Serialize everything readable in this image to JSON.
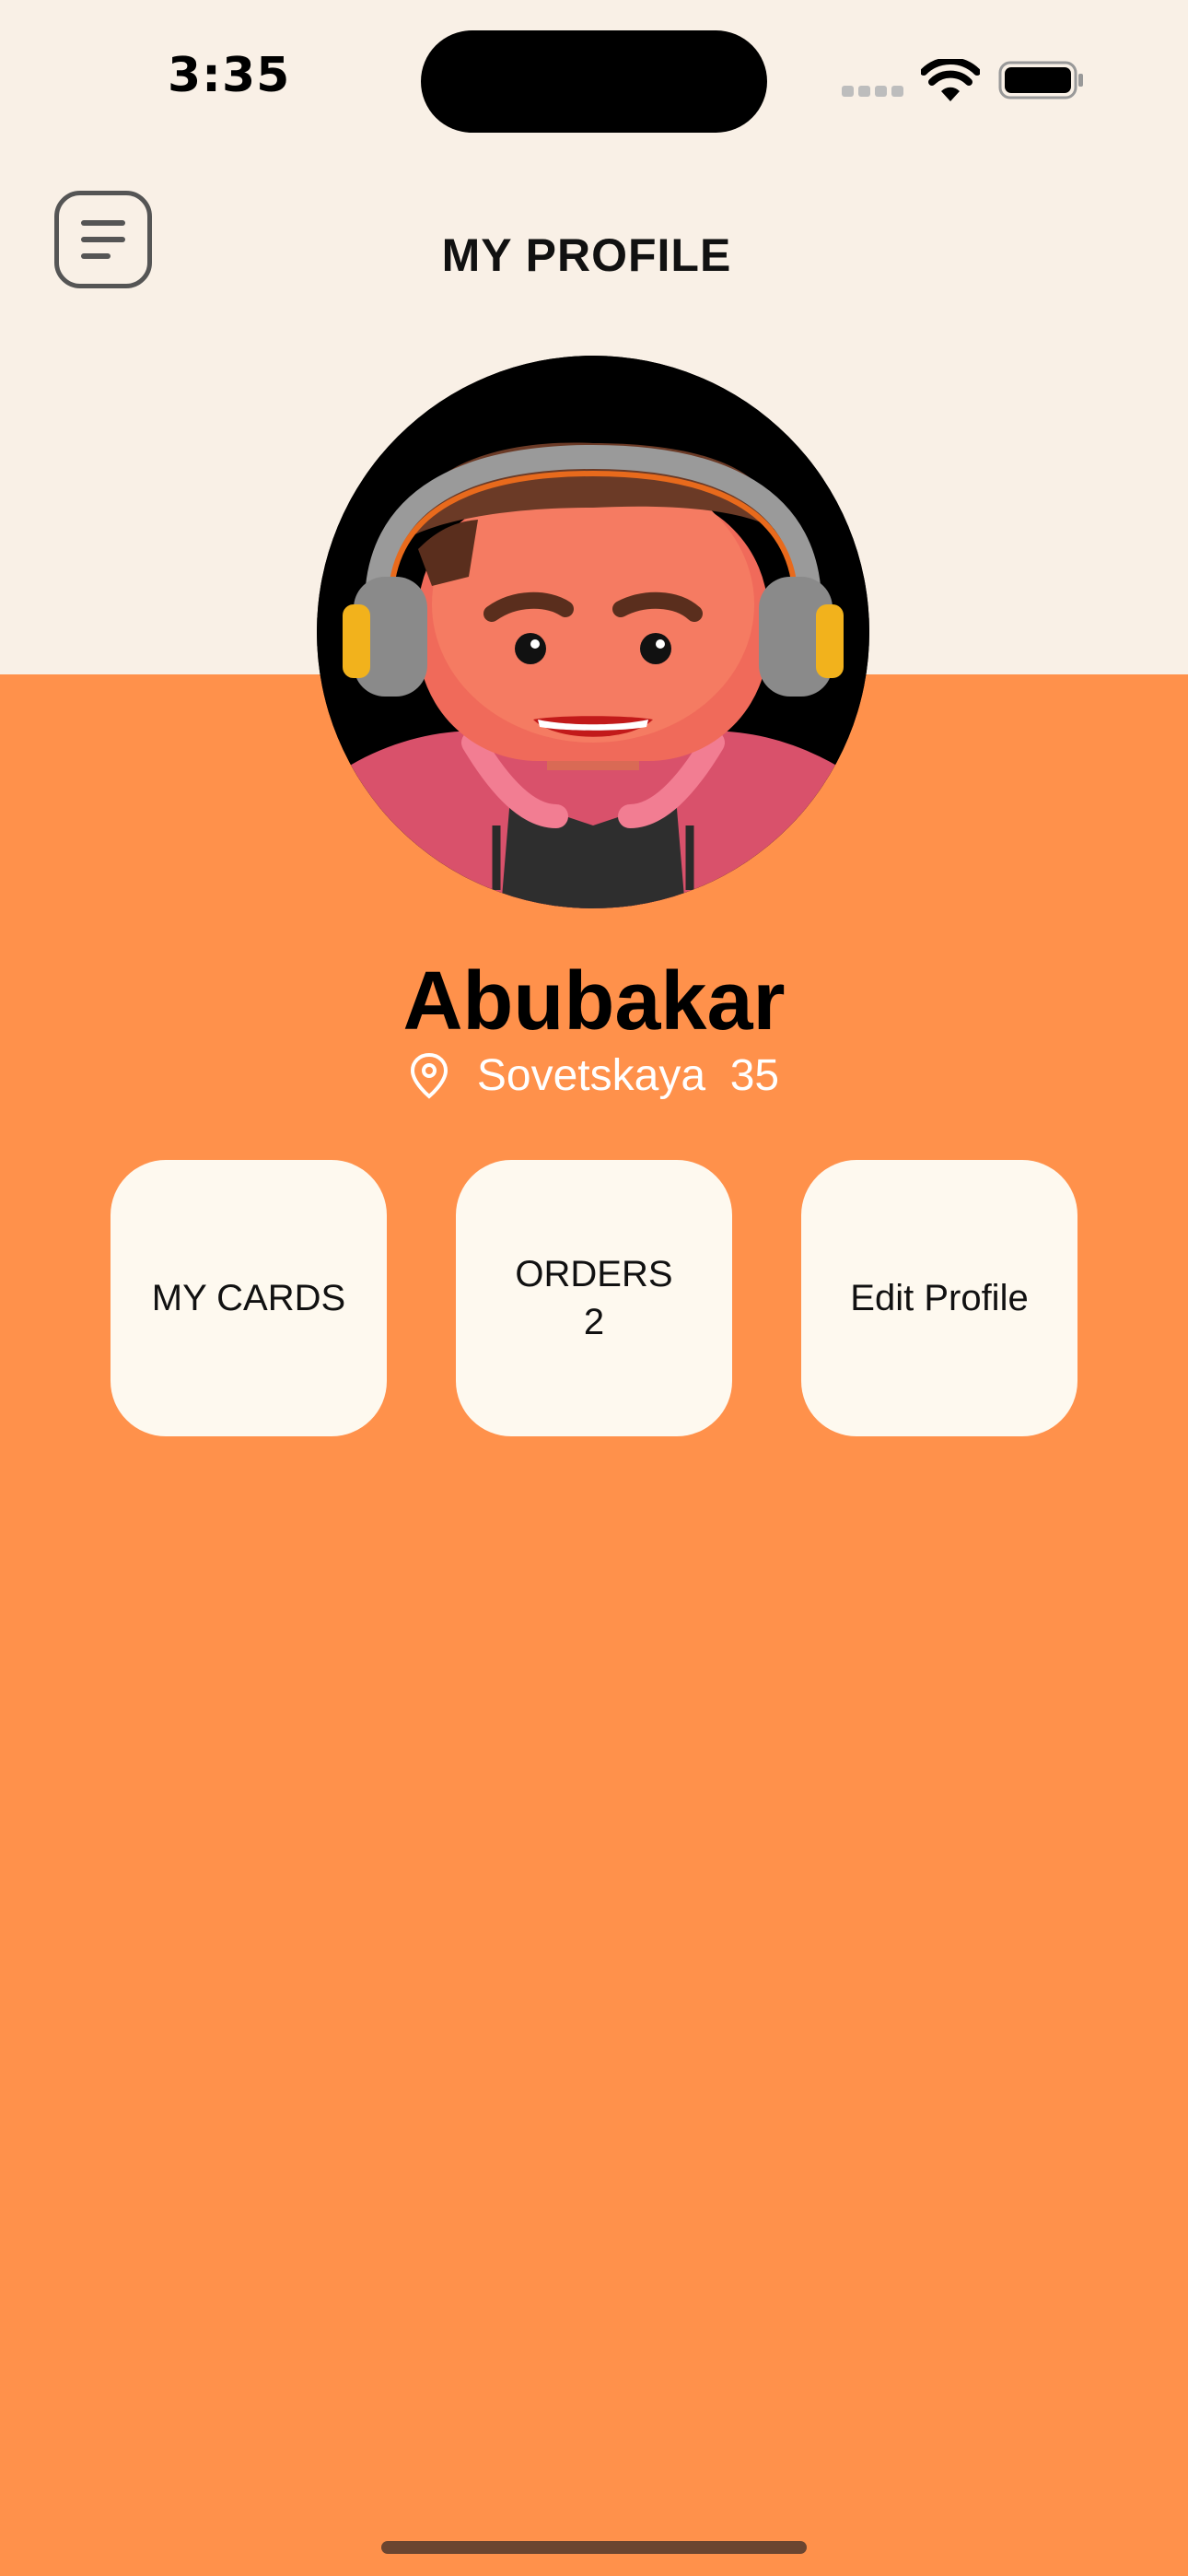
{
  "status_bar": {
    "time": "3:35"
  },
  "header": {
    "title": "MY PROFILE",
    "menu_icon": "menu-list-icon"
  },
  "profile": {
    "avatar_icon": "avatar-headphones-illustration",
    "name": "Abubakar",
    "location_icon": "map-pin-icon",
    "location": "Sovetskaya  35"
  },
  "actions": [
    {
      "label": "MY CARDS",
      "sub": ""
    },
    {
      "label": "ORDERS",
      "sub": "2"
    },
    {
      "label": "Edit Profile",
      "sub": ""
    }
  ],
  "colors": {
    "background_top": "#F9F0E6",
    "background_accent": "#FF914B",
    "card_background": "#FEF9EF",
    "text_primary": "#000000",
    "text_on_accent": "#FFFFFF"
  }
}
